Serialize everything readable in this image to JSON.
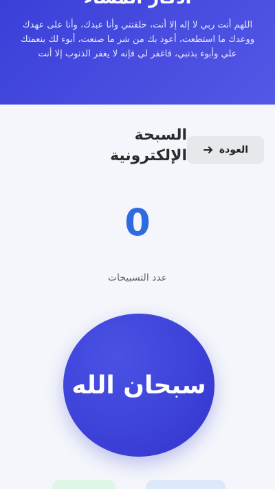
{
  "hero": {
    "title": "أذكار المساء",
    "dua": "اللهم أنت ربي لا إله إلا أنت، خلقتني وأنا عبدك، وأنا على عهدك ووعدك ما استطعت، أعوذ بك من شر ما صنعت، أبوء لك بنعمتك علي وأبوء بذنبي، فاغفر لي فإنه لا يغفر الذنوب إلا أنت"
  },
  "header": {
    "page_title": "السبحة الإلكترونية",
    "back_label": "العودة",
    "back_icon": "arrow-right-icon"
  },
  "counter": {
    "value": "0",
    "label": "عدد التسبيحات"
  },
  "tasbih": {
    "label": "سبحان الله"
  },
  "actions": {
    "reset_label": "",
    "save_label": ""
  },
  "colors": {
    "primary": "#3b3fd6",
    "counter": "#2f6ae0",
    "background": "#f4f6fb"
  }
}
